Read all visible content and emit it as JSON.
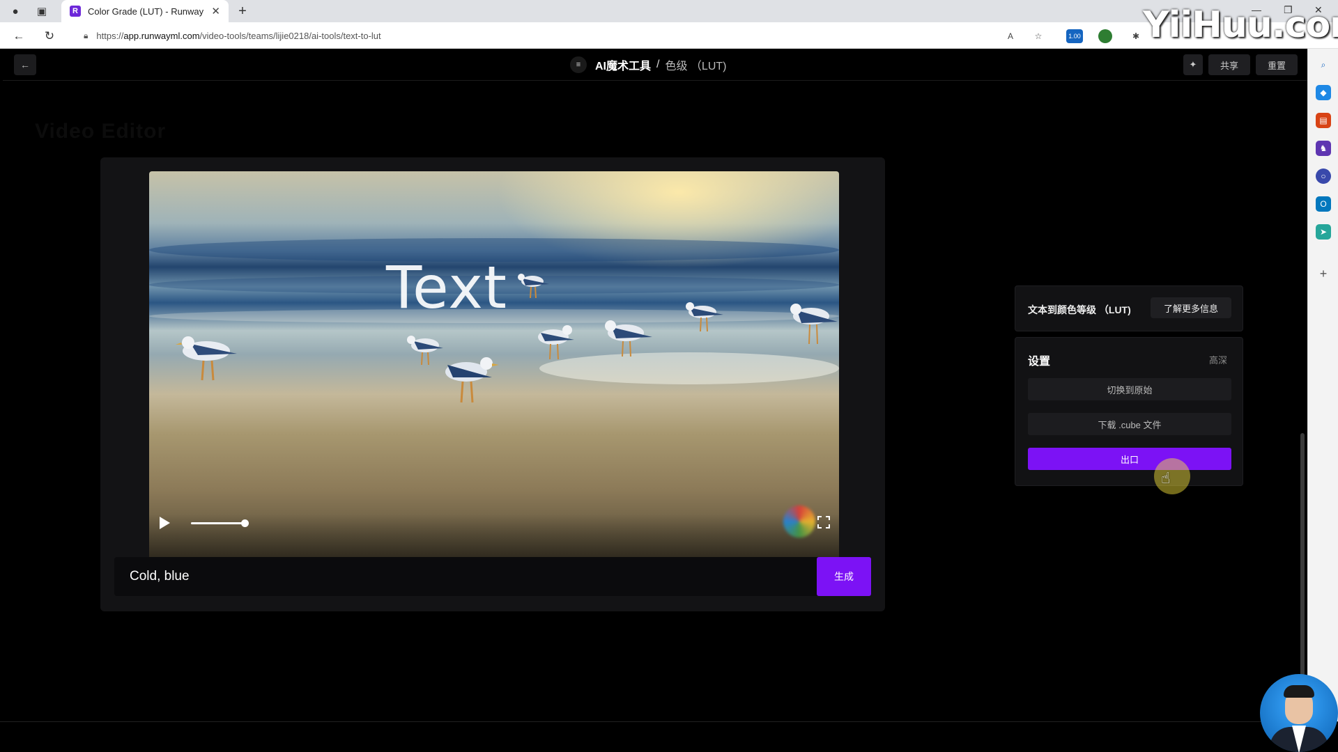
{
  "browser": {
    "tab_title": "Color Grade (LUT) - Runway",
    "tab_favicon": "R",
    "url_prefix": "https://",
    "url_domain": "app.runwayml.com",
    "url_path": "/video-tools/teams/lijie0218/ai-tools/text-to-lut",
    "extension_badge": "1.00",
    "watermark": "YiiHuu.com"
  },
  "header": {
    "logo_glyph": "≡",
    "title_main": "AI魔术工具",
    "separator": "/",
    "title_sub": "色级 （LUT)",
    "share_label": "共享",
    "reset_label": "重置",
    "back_glyph": "←",
    "spark_glyph": "✦"
  },
  "editor": {
    "faint_title": "Video Editor",
    "video_overlay_text": "Text",
    "prompt_value": "Cold, blue",
    "generate_label": "生成",
    "volume_level": 0.8,
    "playback_progress": 0.0
  },
  "info_panel": {
    "title": "文本到颜色等级 （LUT)",
    "learn_more_label": "了解更多信息"
  },
  "settings_panel": {
    "title": "设置",
    "advanced_label": "高深",
    "toggle_original_label": "切换到原始",
    "download_cube_label": "下载 .cube 文件",
    "export_label": "出口"
  },
  "colors": {
    "accent_purple": "#7c12f5",
    "panel_bg": "#121214",
    "app_bg": "#000000"
  },
  "icons": {
    "back": "arrow-left-icon",
    "reload": "reload-icon",
    "play": "play-icon",
    "fullscreen": "fullscreen-icon",
    "search": "search-icon"
  }
}
